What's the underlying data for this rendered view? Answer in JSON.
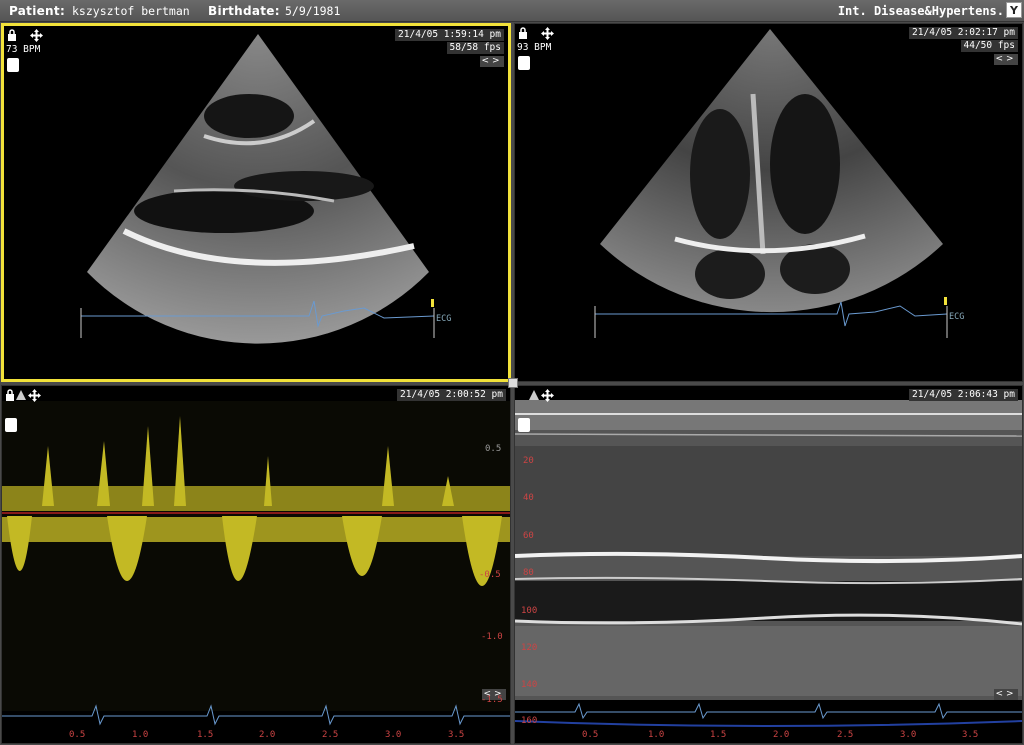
{
  "header": {
    "patient_label": "Patient:",
    "patient_name": "kszysztof bertman",
    "birthdate_label": "Birthdate:",
    "birthdate": "5/9/1981",
    "department": "Int. Disease&Hypertens.",
    "menu_icon": "Y"
  },
  "panels": [
    {
      "timestamp": "21/4/05 1:59:14 pm",
      "fps": "58/58 fps",
      "bpm": "73 BPM",
      "ecg_label": "ECG",
      "selected": true
    },
    {
      "timestamp": "21/4/05 2:02:17 pm",
      "fps": "44/50 fps",
      "bpm": "93 BPM",
      "ecg_label": "ECG",
      "selected": false
    },
    {
      "timestamp": "21/4/05 2:00:52 pm",
      "scale": [
        "0.5",
        "-0.5",
        "-1.0",
        "-1.5"
      ],
      "time_axis": [
        "0.5",
        "1.0",
        "1.5",
        "2.0",
        "2.5",
        "3.0",
        "3.5"
      ]
    },
    {
      "timestamp": "21/4/05 2:06:43 pm",
      "depth_scale": [
        "20",
        "40",
        "60",
        "80",
        "100",
        "120",
        "140",
        "160"
      ],
      "time_axis": [
        "0.5",
        "1.0",
        "1.5",
        "2.0",
        "2.5",
        "3.0",
        "3.5"
      ]
    }
  ],
  "nav_arrows": "<>",
  "colors": {
    "selected_border": "#f2e23a",
    "doppler": "#f0e030",
    "baseline": "#b02020",
    "ecg": "#6a9ad0",
    "scale": "#c44444"
  }
}
